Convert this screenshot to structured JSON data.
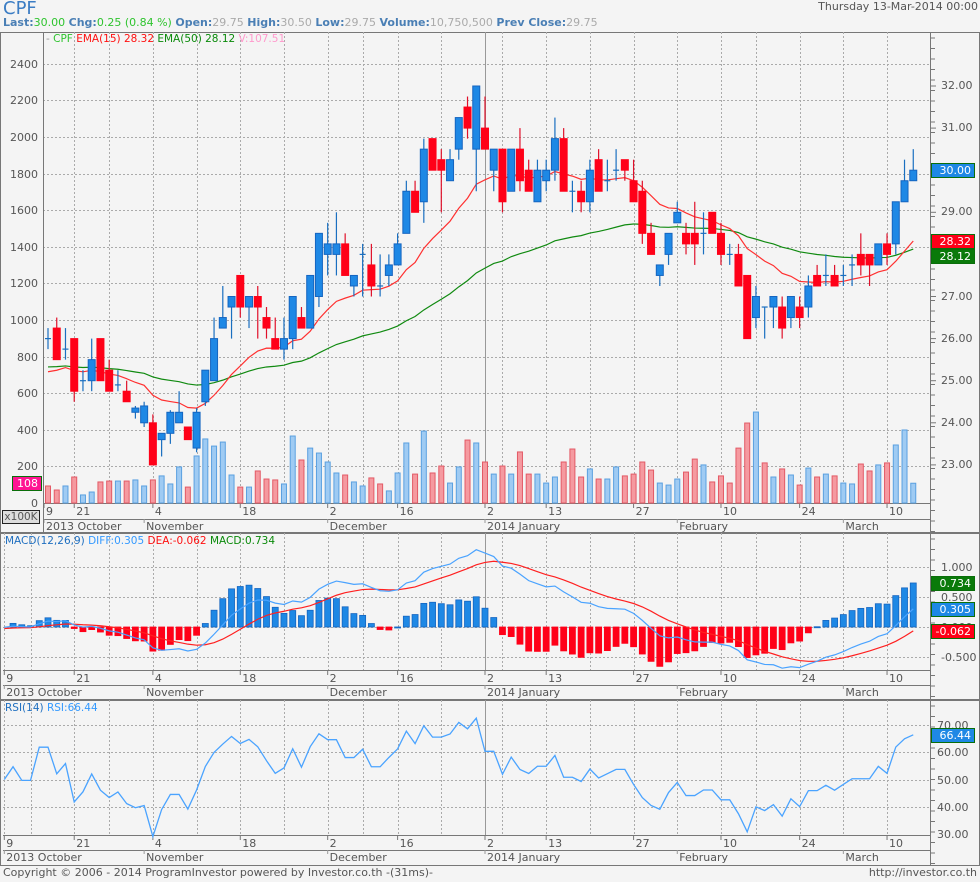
{
  "header": {
    "symbol": "CPF",
    "datetime": "Thursday 13-Mar-2014 00:00",
    "last_label": "Last:",
    "last": "30.00",
    "chg_label": "Chg:",
    "chg": "0.25 (0.84 %)",
    "open_label": "Open:",
    "open": "29.75",
    "high_label": "High:",
    "high": "30.50",
    "low_label": "Low:",
    "low": "29.75",
    "volume_label": "Volume:",
    "volume": "10,750,500",
    "prev_close_label": "Prev Close:",
    "prev_close": "29.75"
  },
  "main_legend": {
    "symbol": "CPF",
    "ema15": "EMA(15) 28.32",
    "ema50": "EMA(50) 28.12",
    "vol": "V:107.51"
  },
  "macd_legend": {
    "name": "MACD(12,26,9)",
    "diff": "DIFF:0.305",
    "dea": "DEA:-0.062",
    "macd": "MACD:0.734"
  },
  "rsi_legend": {
    "name": "RSI(14)",
    "rsi": "RSI:66.44"
  },
  "volume_unit": "x100K",
  "footer": {
    "copyright": "Copyright © 2006 - 2014 ProgramInvestor powered by Investor.co.th -(31ms)-",
    "url": "http://investor.co.th"
  },
  "colors": {
    "up": "#1e88e5",
    "down": "#ff0018",
    "ema15": "#ff3030",
    "ema50": "#108a10",
    "diff": "#4aa3ff",
    "dea": "#ff2020",
    "rsi": "#4aa3ff",
    "vol_tag": "#ff1493"
  },
  "chart_data": [
    {
      "type": "candlestick",
      "title": "CPF",
      "ohlc_fields": [
        "open",
        "high",
        "low",
        "close"
      ],
      "ohlc": [
        [
          26.0,
          26.25,
          25.75,
          26.0
        ],
        [
          26.25,
          26.5,
          25.5,
          25.5
        ],
        [
          25.75,
          26.25,
          25.5,
          25.75
        ],
        [
          26.0,
          26.0,
          24.5,
          24.75
        ],
        [
          25.0,
          25.25,
          24.75,
          25.0
        ],
        [
          25.0,
          26.0,
          24.75,
          25.5
        ],
        [
          26.0,
          26.0,
          25.0,
          25.0
        ],
        [
          25.25,
          25.5,
          24.75,
          24.75
        ],
        [
          24.9,
          25.25,
          24.75,
          24.9
        ],
        [
          24.75,
          25.0,
          24.5,
          24.5
        ],
        [
          24.25,
          24.4,
          24.1,
          24.35
        ],
        [
          24.0,
          24.5,
          23.9,
          24.4
        ],
        [
          24.0,
          24.2,
          23.0,
          23.0
        ],
        [
          23.6,
          23.75,
          23.2,
          23.75
        ],
        [
          23.75,
          24.3,
          23.5,
          24.25
        ],
        [
          24.0,
          24.75,
          24.0,
          24.25
        ],
        [
          23.9,
          23.9,
          23.6,
          23.6
        ],
        [
          23.4,
          24.35,
          23.3,
          24.25
        ],
        [
          24.5,
          25.25,
          24.4,
          25.25
        ],
        [
          25.0,
          26.5,
          25.0,
          26.0
        ],
        [
          26.25,
          27.25,
          26.25,
          26.5
        ],
        [
          26.75,
          27.0,
          26.0,
          27.0
        ],
        [
          27.5,
          27.5,
          26.5,
          26.75
        ],
        [
          26.75,
          27.0,
          26.25,
          27.0
        ],
        [
          27.0,
          27.25,
          26.0,
          26.75
        ],
        [
          26.5,
          26.75,
          26.0,
          26.25
        ],
        [
          26.0,
          26.5,
          25.75,
          25.75
        ],
        [
          25.75,
          26.5,
          25.5,
          26.0
        ],
        [
          26.0,
          27.0,
          25.75,
          27.0
        ],
        [
          26.5,
          26.75,
          26.25,
          26.25
        ],
        [
          26.25,
          27.5,
          26.25,
          27.5
        ],
        [
          27.0,
          28.5,
          26.75,
          28.5
        ],
        [
          28.0,
          28.75,
          27.5,
          28.25
        ],
        [
          28.0,
          29.0,
          27.5,
          28.25
        ],
        [
          28.25,
          28.5,
          27.5,
          27.5
        ],
        [
          27.25,
          27.5,
          27.0,
          27.5
        ],
        [
          28.0,
          28.25,
          27.0,
          28.0
        ],
        [
          27.75,
          28.25,
          27.0,
          27.25
        ],
        [
          27.25,
          28.0,
          27.0,
          27.25
        ],
        [
          27.5,
          28.0,
          27.25,
          27.75
        ],
        [
          27.75,
          28.5,
          27.75,
          28.25
        ],
        [
          28.5,
          29.75,
          28.5,
          29.5
        ],
        [
          29.5,
          29.75,
          29.0,
          29.0
        ],
        [
          29.25,
          30.75,
          28.75,
          30.5
        ],
        [
          30.75,
          30.75,
          30.0,
          30.0
        ],
        [
          30.25,
          30.5,
          29.0,
          30.0
        ],
        [
          29.75,
          30.5,
          29.75,
          30.25
        ],
        [
          30.5,
          31.25,
          30.25,
          31.25
        ],
        [
          31.5,
          31.75,
          30.75,
          31.0
        ],
        [
          30.5,
          32.0,
          29.5,
          32.0
        ],
        [
          31.0,
          31.75,
          30.5,
          30.5
        ],
        [
          30.0,
          30.5,
          29.5,
          30.5
        ],
        [
          30.5,
          30.5,
          29.0,
          29.25
        ],
        [
          29.5,
          30.5,
          29.5,
          30.5
        ],
        [
          30.5,
          31.0,
          29.5,
          29.75
        ],
        [
          30.0,
          30.25,
          29.5,
          29.5
        ],
        [
          29.25,
          30.25,
          29.25,
          30.0
        ],
        [
          29.75,
          30.25,
          29.5,
          30.0
        ],
        [
          30.0,
          31.25,
          29.75,
          30.75
        ],
        [
          30.75,
          31.0,
          29.5,
          29.5
        ],
        [
          29.5,
          29.75,
          29.0,
          29.5
        ],
        [
          29.5,
          29.75,
          29.0,
          29.25
        ],
        [
          29.25,
          30.25,
          29.0,
          30.0
        ],
        [
          30.25,
          30.5,
          29.5,
          29.5
        ],
        [
          29.75,
          30.25,
          29.5,
          29.75
        ],
        [
          30.0,
          30.5,
          29.75,
          30.0
        ],
        [
          30.25,
          30.25,
          29.75,
          30.0
        ],
        [
          29.75,
          30.25,
          29.25,
          29.25
        ],
        [
          29.5,
          29.75,
          28.25,
          28.5
        ],
        [
          28.5,
          28.75,
          28.0,
          28.0
        ],
        [
          27.5,
          27.75,
          27.25,
          27.75
        ],
        [
          28.0,
          28.5,
          27.75,
          28.5
        ],
        [
          28.75,
          29.25,
          28.75,
          29.0
        ],
        [
          28.5,
          28.75,
          28.0,
          28.25
        ],
        [
          28.5,
          29.25,
          27.75,
          28.25
        ],
        [
          28.5,
          29.0,
          28.0,
          28.5
        ],
        [
          29.0,
          29.0,
          28.5,
          28.5
        ],
        [
          28.5,
          28.75,
          27.75,
          28.0
        ],
        [
          28.0,
          28.25,
          27.75,
          28.0
        ],
        [
          28.0,
          28.25,
          27.25,
          27.25
        ],
        [
          27.5,
          27.5,
          26.0,
          26.0
        ],
        [
          26.5,
          27.25,
          26.25,
          27.0
        ],
        [
          26.75,
          26.75,
          26.0,
          26.75
        ],
        [
          26.75,
          27.0,
          26.25,
          27.0
        ],
        [
          26.75,
          27.0,
          26.0,
          26.25
        ],
        [
          26.5,
          27.0,
          26.25,
          27.0
        ],
        [
          26.75,
          27.0,
          26.25,
          26.5
        ],
        [
          26.75,
          27.5,
          26.5,
          27.25
        ],
        [
          27.5,
          27.75,
          27.25,
          27.25
        ],
        [
          27.5,
          28.0,
          27.25,
          27.5
        ],
        [
          27.5,
          27.75,
          27.25,
          27.25
        ],
        [
          27.5,
          27.75,
          27.25,
          27.5
        ],
        [
          27.75,
          28.0,
          27.25,
          27.75
        ],
        [
          28.0,
          28.5,
          27.5,
          27.75
        ],
        [
          28.0,
          28.0,
          27.25,
          27.75
        ],
        [
          27.75,
          28.25,
          27.75,
          28.25
        ],
        [
          28.25,
          28.5,
          27.75,
          28.0
        ],
        [
          28.25,
          29.25,
          28.0,
          29.25
        ],
        [
          29.25,
          30.25,
          29.25,
          29.75
        ],
        [
          29.75,
          30.5,
          29.75,
          30.0
        ]
      ],
      "pre_closes": [
        25.25,
        25.5,
        25.25,
        25.25,
        26.0
      ],
      "volume_x100k": [
        93,
        71,
        93,
        142,
        44,
        60,
        115,
        120,
        120,
        120,
        126,
        93,
        126,
        148,
        104,
        197,
        87,
        257,
        350,
        311,
        333,
        153,
        87,
        87,
        175,
        131,
        126,
        104,
        366,
        235,
        300,
        273,
        224,
        164,
        153,
        115,
        93,
        137,
        104,
        66,
        164,
        328,
        158,
        393,
        164,
        202,
        109,
        197,
        344,
        328,
        224,
        158,
        202,
        158,
        279,
        158,
        158,
        109,
        142,
        224,
        295,
        142,
        186,
        131,
        131,
        197,
        148,
        158,
        224,
        180,
        109,
        98,
        131,
        169,
        240,
        208,
        115,
        148,
        109,
        300,
        437,
        497,
        219,
        142,
        186,
        153,
        98,
        191,
        142,
        158,
        148,
        109,
        104,
        213,
        175,
        208,
        219,
        317,
        399,
        108
      ],
      "indicators": {
        "ema15_seed": 25.1,
        "ema50_seed": 25.3,
        "ema15_last": "28.32",
        "ema50_last": "28.12"
      },
      "price_axis": {
        "min": 23,
        "max": 32,
        "labels": [
          "32.00",
          "31.00",
          "30.00",
          "29.00",
          "28.00",
          "27.00",
          "26.00",
          "25.00",
          "24.00",
          "23.00"
        ],
        "position": "right"
      },
      "volume_axis": {
        "min": 0,
        "max": 2400,
        "labels": [
          "2400",
          "2200",
          "2000",
          "1800",
          "1600",
          "1400",
          "1200",
          "1000",
          "800",
          "600",
          "400",
          "200",
          "0"
        ],
        "position": "left"
      },
      "price_tags": [
        {
          "value": 30.0,
          "label": "30.00",
          "color": "#1e88e5"
        },
        {
          "value": 28.32,
          "label": "28.32",
          "color": "#ff0018"
        },
        {
          "value": 28.12,
          "label": "28.12",
          "color": "#0a7a0a"
        }
      ],
      "volume_tag": {
        "value": 108,
        "label": "108"
      },
      "grid": true
    },
    {
      "type": "line+bar",
      "title": "MACD(12,26,9)",
      "seeds": {
        "ema12": 25.3,
        "ema26": 25.3,
        "dea": -0.03
      },
      "axis": {
        "labels": [
          {
            "v": 1.0,
            "t": "1.000"
          },
          {
            "v": 0.5,
            "t": "0.500"
          },
          {
            "v": 0.0,
            "t": "0.000"
          },
          {
            "v": -0.5,
            "t": "-0.500"
          }
        ],
        "position": "right"
      },
      "tags": [
        {
          "value": 0.734,
          "label": "0.734",
          "color": "#0a7a0a"
        },
        {
          "value": 0.305,
          "label": "0.305",
          "color": "#1e88e5"
        },
        {
          "value": -0.062,
          "label": "-0.062",
          "color": "#ff0018"
        }
      ]
    },
    {
      "type": "line",
      "title": "RSI(14)",
      "seeds": {
        "avg_gain": 0.1,
        "avg_loss": 0.1
      },
      "axis": {
        "min": 30,
        "max": 70,
        "labels": [
          {
            "v": 70,
            "t": "70.00"
          },
          {
            "v": 60,
            "t": "60.00"
          },
          {
            "v": 50,
            "t": "50.00"
          },
          {
            "v": 40,
            "t": "40.00"
          },
          {
            "v": 30,
            "t": "30.00"
          }
        ],
        "position": "right"
      },
      "tags": [
        {
          "value": 66.44,
          "label": "66.44",
          "color": "#1e88e5"
        }
      ]
    }
  ],
  "x_axis": {
    "day_ticks": [
      {
        "i": -5,
        "label": "9"
      },
      {
        "i": 3,
        "label": "21"
      },
      {
        "i": 12,
        "label": "4"
      },
      {
        "i": 22,
        "label": "18"
      },
      {
        "i": 32,
        "label": "2"
      },
      {
        "i": 40,
        "label": "16"
      },
      {
        "i": 50,
        "label": "2"
      },
      {
        "i": 57,
        "label": "13"
      },
      {
        "i": 67,
        "label": "27"
      },
      {
        "i": 77,
        "label": "10"
      },
      {
        "i": 86,
        "label": "24"
      },
      {
        "i": 96,
        "label": "10"
      }
    ],
    "week_lines": [
      -2,
      7,
      17,
      27,
      36,
      45,
      52,
      62,
      72,
      81,
      91
    ],
    "months": [
      {
        "i": -5,
        "label": "2013 October"
      },
      {
        "i": 11,
        "label": "November"
      },
      {
        "i": 32,
        "label": "December"
      },
      {
        "i": 50,
        "label": "2014 January"
      },
      {
        "i": 72,
        "label": "February"
      },
      {
        "i": 91,
        "label": "March"
      }
    ],
    "year_break": 50
  }
}
